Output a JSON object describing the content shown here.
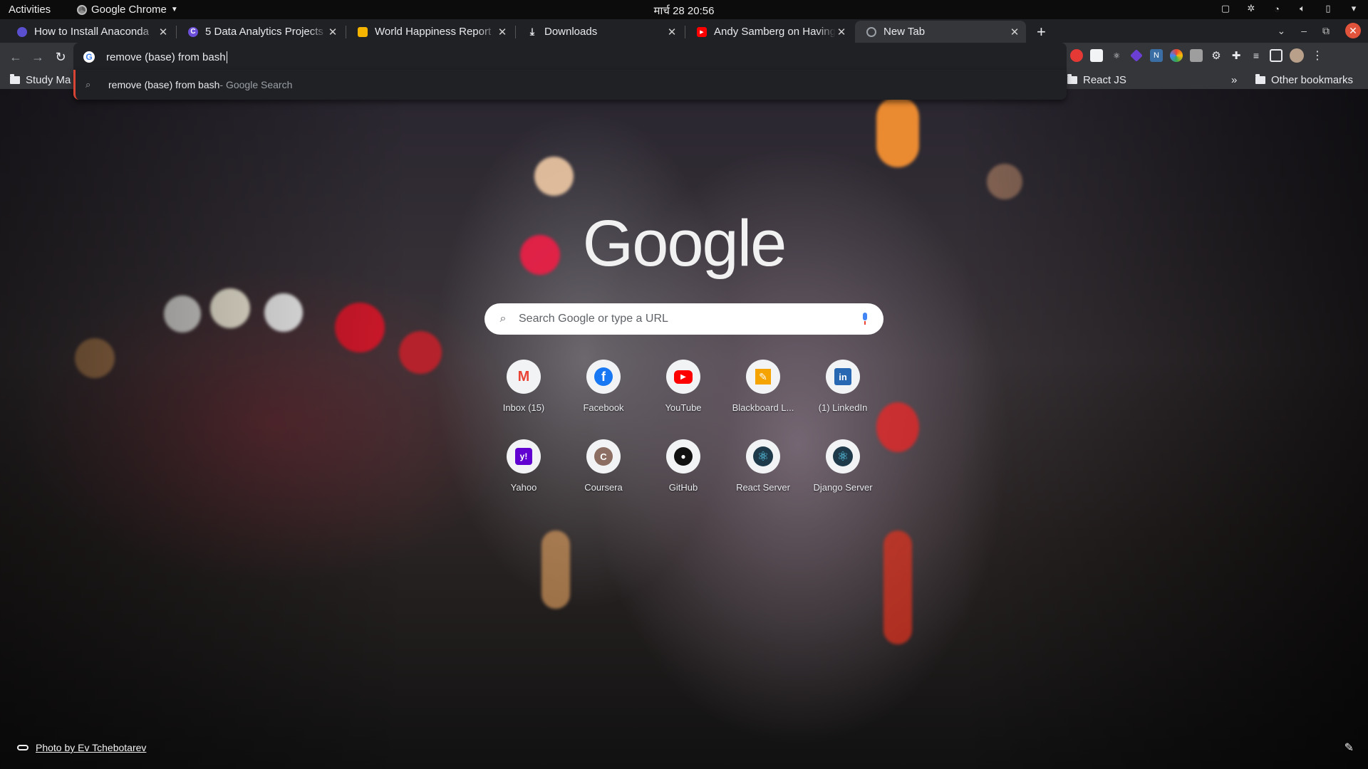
{
  "system_bar": {
    "activities": "Activities",
    "app_name": "Google Chrome",
    "clock": "मार्च 28  20:56"
  },
  "tabs": [
    {
      "title": "How to Install Anaconda",
      "favicon": "anaconda-icon",
      "color": "#5a4fcf"
    },
    {
      "title": "5 Data Analytics Projects",
      "favicon": "coursera-c-icon",
      "color": "#6b4fd8"
    },
    {
      "title": "World Happiness Report",
      "favicon": "slides-icon",
      "color": "#f4b400"
    },
    {
      "title": "Downloads",
      "favicon": "download-icon",
      "color": "#e8eaed"
    },
    {
      "title": "Andy Samberg on Having",
      "favicon": "youtube-icon",
      "color": "#ff0000"
    },
    {
      "title": "New Tab",
      "favicon": "chrome-icon",
      "color": "#9aa0a6",
      "active": true
    }
  ],
  "omnibox": {
    "value": "remove (base) from bash"
  },
  "suggestion": {
    "text": "remove (base) from bash",
    "desc": " - Google Search"
  },
  "bookmarks": {
    "left": "Study Ma",
    "right": "React JS",
    "more": "»",
    "other": "Other bookmarks"
  },
  "ntp": {
    "logo": "Google",
    "search_placeholder": "Search Google or type a URL",
    "shortcuts": [
      {
        "label": "Inbox (15)",
        "icon": "gmail-icon",
        "glyph": "M",
        "color": "#ea4335"
      },
      {
        "label": "Facebook",
        "icon": "facebook-icon",
        "glyph": "f",
        "color": "#1877f2"
      },
      {
        "label": "YouTube",
        "icon": "youtube-icon",
        "glyph": "▶",
        "color": "#ff0000"
      },
      {
        "label": "Blackboard L...",
        "icon": "blackboard-icon",
        "glyph": "✎",
        "color": "#f4a300"
      },
      {
        "label": "(1) LinkedIn",
        "icon": "linkedin-icon",
        "glyph": "in",
        "color": "#0a66c2"
      },
      {
        "label": "Yahoo",
        "icon": "yahoo-icon",
        "glyph": "y!",
        "color": "#6001d2"
      },
      {
        "label": "Coursera",
        "icon": "coursera-icon",
        "glyph": "C",
        "color": "#8d6e63"
      },
      {
        "label": "GitHub",
        "icon": "github-icon",
        "glyph": "●",
        "color": "#111111"
      },
      {
        "label": "React Server",
        "icon": "react-icon",
        "glyph": "⚛",
        "color": "#1e6f8f"
      },
      {
        "label": "Django Server",
        "icon": "react-icon",
        "glyph": "⚛",
        "color": "#1e6f8f"
      }
    ],
    "photo_credit": "Photo by Ev Tchebotarev"
  }
}
